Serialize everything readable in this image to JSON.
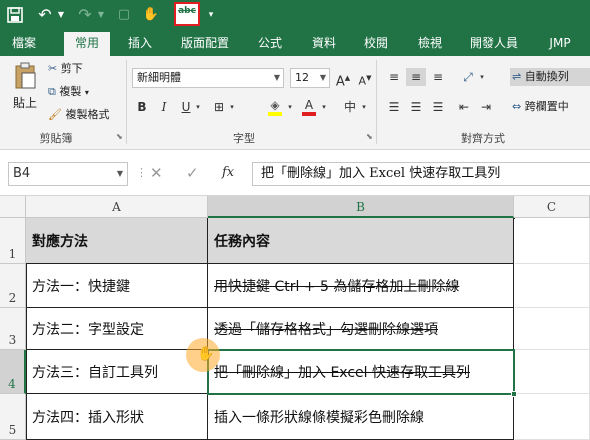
{
  "qat": {
    "save_icon": "save-icon",
    "undo_icon": "undo-icon",
    "redo_icon": "redo-icon",
    "spelling_label": "abc",
    "highlight_color": "#e02020"
  },
  "tabs": [
    "檔案",
    "常用",
    "插入",
    "版面配置",
    "公式",
    "資料",
    "校閱",
    "檢視",
    "開發人員",
    "JMP"
  ],
  "active_tab": "常用",
  "ribbon": {
    "clipboard": {
      "paste": "貼上",
      "cut": "剪下",
      "copy": "複製",
      "format_painter": "複製格式",
      "label": "剪貼簿"
    },
    "font": {
      "name": "新細明體",
      "size": "12",
      "grow": "A",
      "shrink": "A",
      "bold": "B",
      "italic": "I",
      "underline": "U",
      "phonetic": "中",
      "font_color_letter": "A",
      "label": "字型"
    },
    "alignment": {
      "wrap_text": "自動換列",
      "merge_center": "跨欄置中",
      "label": "對齊方式"
    }
  },
  "formula_bar": {
    "name_box": "B4",
    "fx": "fx",
    "formula": "把「刪除線」加入 Excel 快速存取工具列"
  },
  "sheet": {
    "columns": [
      "A",
      "B",
      "C"
    ],
    "rows": [
      "1",
      "2",
      "3",
      "4",
      "5"
    ],
    "cells": [
      [
        "對應方法",
        "任務內容"
      ],
      [
        "方法一：快捷鍵",
        "用快捷鍵 Ctrl + 5 為儲存格加上刪除線"
      ],
      [
        "方法二：字型設定",
        "透過「儲存格格式」勾選刪除線選項"
      ],
      [
        "方法三：自訂工具列",
        "把「刪除線」加入 Excel 快速存取工具列"
      ],
      [
        "方法四：插入形狀",
        "插入一條形狀線條模擬彩色刪除線"
      ]
    ],
    "strike": [
      false,
      true,
      true,
      true,
      false
    ],
    "selected_cell": "B4",
    "header_fill": "#d9d9d9",
    "accent": "#217346"
  }
}
